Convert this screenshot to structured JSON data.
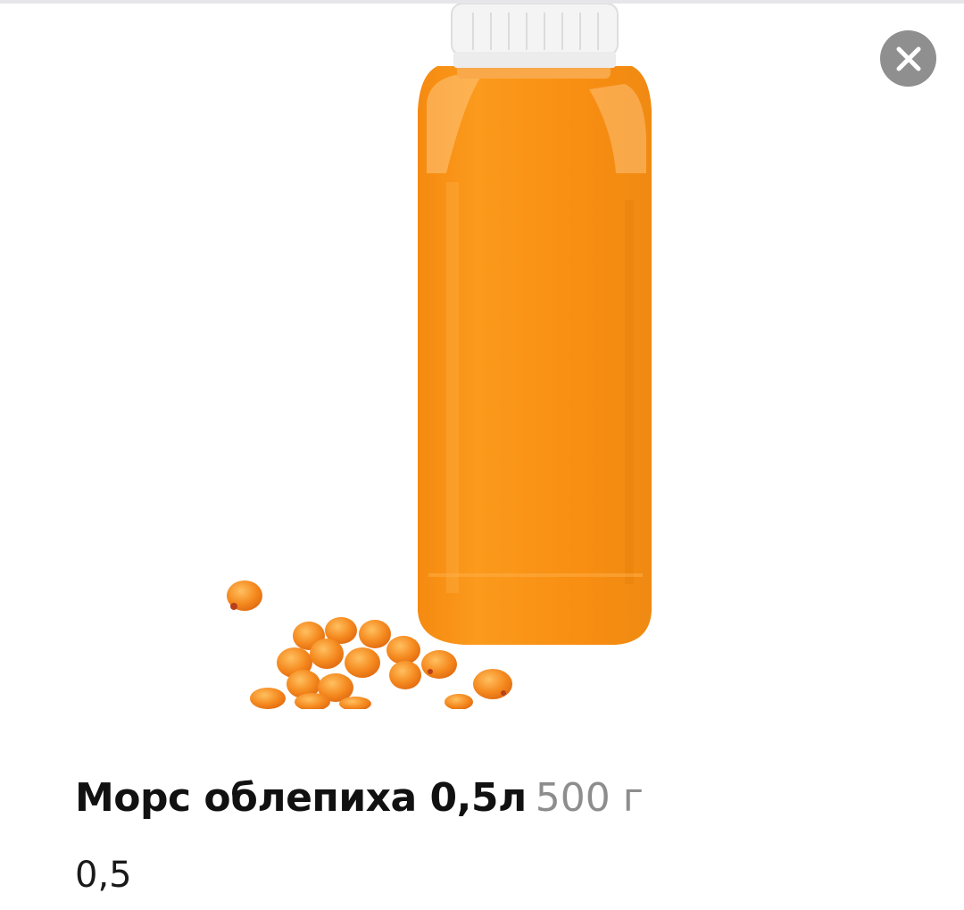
{
  "product": {
    "title": "Морс облепиха 0,5л",
    "weight": "500 г",
    "description": "0,5",
    "image_subject": "sea buckthorn juice bottle with berries"
  },
  "close_button": {
    "icon": "close-icon"
  },
  "colors": {
    "juice": "#f7931e",
    "cap": "#f4f4f4",
    "berry": "#f58a1f",
    "close_bg": "#8f8f8f",
    "weight_text": "#8d8d8d"
  }
}
